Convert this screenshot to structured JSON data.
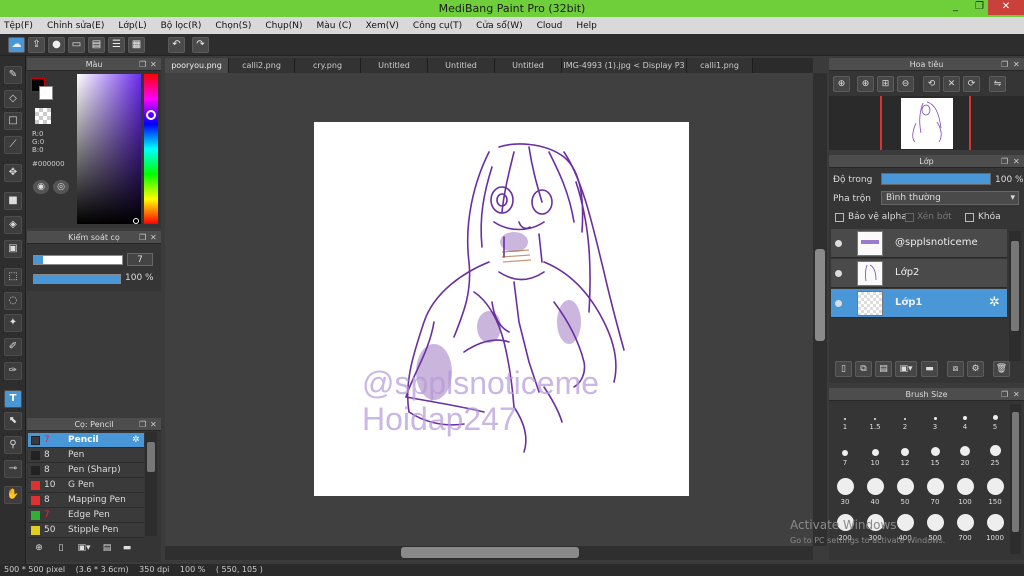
{
  "window": {
    "title": "MediBang Paint Pro (32bit)",
    "minimize": "_",
    "restore": "❐",
    "close": "✕"
  },
  "menu": [
    "Tệp(F)",
    "Chỉnh sửa(E)",
    "Lớp(L)",
    "Bộ lọc(R)",
    "Chọn(S)",
    "Chụp(N)",
    "Màu (C)",
    "Xem(V)",
    "Công cụ(T)",
    "Cửa sổ(W)",
    "Cloud",
    "Help"
  ],
  "tabs": [
    "pooryou.png",
    "calli2.png",
    "cry.png",
    "Untitled",
    "Untitled",
    "Untitled",
    "IMG-4993 (1).jpg < Display P3 >",
    "calli1.png"
  ],
  "color_panel": {
    "title": "Màu",
    "r": "R:0",
    "g": "G:0",
    "b": "B:0",
    "hex": "#000000"
  },
  "brush_control": {
    "title": "Kiểm soát cọ",
    "size": "7",
    "opacity": "100 %"
  },
  "brush_panel": {
    "title": "Cọ: Pencil",
    "items": [
      {
        "num": "7",
        "name": "Pencil",
        "color": "#3a3a3a"
      },
      {
        "num": "8",
        "name": "Pen",
        "color": "#3a3a3a"
      },
      {
        "num": "8",
        "name": "Pen (Sharp)",
        "color": "#3a3a3a"
      },
      {
        "num": "10",
        "name": "G Pen",
        "color": "#e03030"
      },
      {
        "num": "8",
        "name": "Mapping Pen",
        "color": "#e03030"
      },
      {
        "num": "7",
        "name": "Edge Pen",
        "color": "#30b030"
      },
      {
        "num": "50",
        "name": "Stipple Pen",
        "color": "#e0d020"
      }
    ]
  },
  "navigator": {
    "title": "Hoa tiêu"
  },
  "layers": {
    "title": "Lớp",
    "opacity_label": "Độ trong",
    "opacity_value": "100 %",
    "opacity_fraction": 1.0,
    "blend_label": "Pha trộn",
    "blend_value": "Bình thường",
    "protect_alpha": "Bảo vệ alpha",
    "clip": "Xén bớt",
    "lock": "Khóa",
    "items": [
      {
        "name": "@spplsnoticeme",
        "selected": false
      },
      {
        "name": "Lớp2",
        "selected": false
      },
      {
        "name": "Lớp1",
        "selected": true
      }
    ]
  },
  "brush_size": {
    "title": "Brush Size",
    "sizes": [
      "1",
      "1.5",
      "2",
      "3",
      "4",
      "5",
      "7",
      "10",
      "12",
      "15",
      "20",
      "25",
      "30",
      "40",
      "50",
      "70",
      "100",
      "150",
      "200",
      "300",
      "400",
      "500",
      "700",
      "1000"
    ]
  },
  "watermark": {
    "line1": "@spplsnoticeme",
    "line2": "Hoidap247"
  },
  "activate": {
    "line1": "Activate Windows",
    "line2": "Go to PC settings to activate Windows."
  },
  "status": {
    "pixels": "500 * 500 pixel",
    "size": "(3.6 * 3.6cm)",
    "dpi": "350 dpi",
    "zoom": "100 %",
    "coords": "( 550, 105 )"
  },
  "colors": {
    "accent": "#4a97d8",
    "titlebar": "#6fcf3a",
    "sketch": "#6a2fa0"
  }
}
